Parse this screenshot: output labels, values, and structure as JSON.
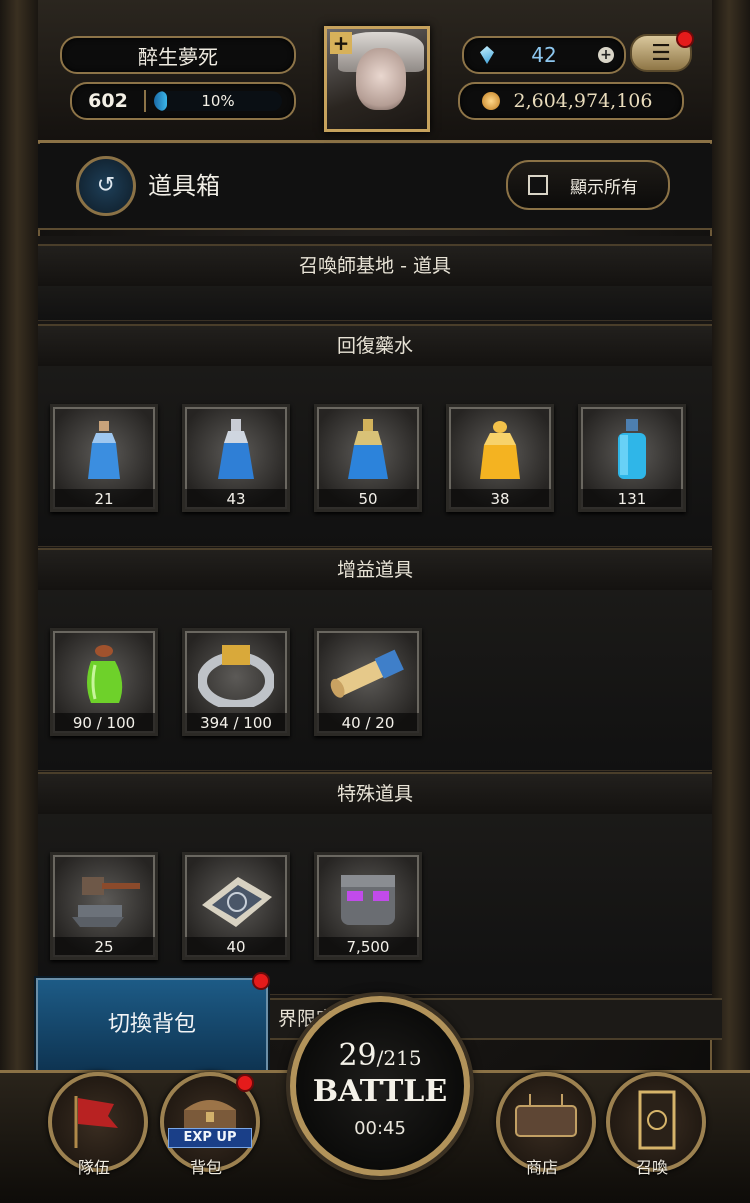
{
  "header": {
    "player_name": "醉生夢死",
    "level": "602",
    "exp_percent_label": "10%",
    "exp_fraction": 0.1,
    "gems": "42",
    "gold": "2,604,974,106",
    "avatar_plus": "+",
    "menu_icon": "☰"
  },
  "titlebar": {
    "back_icon": "↺",
    "title": "道具箱",
    "show_all_label": "顯示所有"
  },
  "sections": [
    {
      "title": "召喚師基地 - 道具",
      "items": []
    },
    {
      "title": "回復藥水",
      "items": [
        {
          "icon": "small-blue-potion-icon",
          "count": "21"
        },
        {
          "icon": "blue-potion-icon",
          "count": "43"
        },
        {
          "icon": "large-blue-potion-icon",
          "count": "50"
        },
        {
          "icon": "gold-potion-icon",
          "count": "38"
        },
        {
          "icon": "cyan-potion-icon",
          "count": "131"
        }
      ]
    },
    {
      "title": "增益道具",
      "items": [
        {
          "icon": "green-potion-icon",
          "count": "90 / 100"
        },
        {
          "icon": "silver-ring-icon",
          "count": "394 / 100"
        },
        {
          "icon": "scroll-icon",
          "count": "40 / 20"
        }
      ]
    },
    {
      "title": "特殊道具",
      "items": [
        {
          "icon": "anvil-hammer-icon",
          "count": "25"
        },
        {
          "icon": "map-tile-icon",
          "count": "40"
        },
        {
          "icon": "stone-golem-cube-icon",
          "count": "7,500"
        }
      ]
    }
  ],
  "partial_section_title": "界限突破 - 精魄",
  "switch_bag_label": "切換背包",
  "battle": {
    "current": "29",
    "max": "/215",
    "label": "BATTLE",
    "timer": "00:45"
  },
  "nav": {
    "team_label": "隊伍",
    "bag_label": "背包",
    "exp_up_badge": "EXP UP",
    "shop_label": "商店",
    "summon_label": "召喚"
  },
  "colors": {
    "gold_trim": "#b2935a",
    "exp_bar": "#3bb7ea",
    "switch_btn": "#1d5b86",
    "notify_red": "#e51b1b"
  }
}
